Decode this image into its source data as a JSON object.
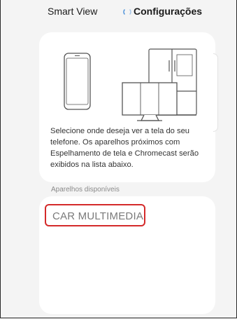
{
  "header": {
    "title": "Smart View",
    "settings_label": "Configurações"
  },
  "info_card": {
    "description": "Selecione onde deseja ver a tela do seu telefone. Os aparelhos próximos com Espelhamento de tela e Chromecast serão exibidos na lista abaixo."
  },
  "devices": {
    "section_label": "Aparelhos disponíveis",
    "items": [
      {
        "label": "CAR MULTIMEDIA"
      }
    ]
  },
  "colors": {
    "background": "#f4f4f4",
    "card": "#ffffff",
    "highlight_border": "#d42a2a",
    "spinner": "#4a90d9"
  }
}
